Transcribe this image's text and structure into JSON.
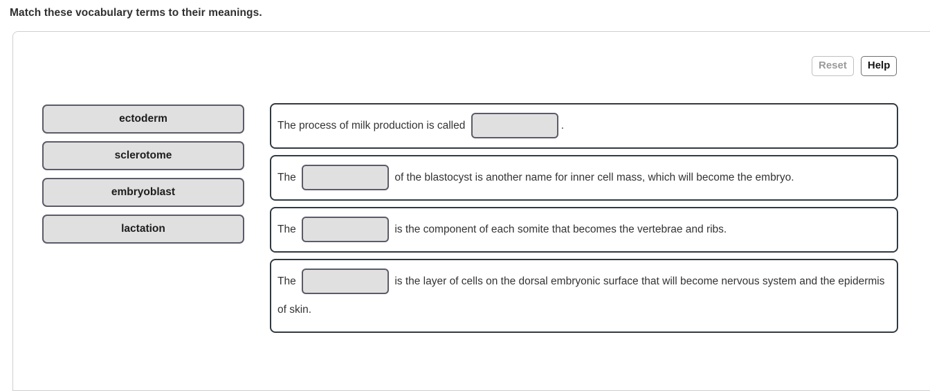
{
  "prompt": "Match these vocabulary terms to their meanings.",
  "toolbar": {
    "reset_label": "Reset",
    "help_label": "Help"
  },
  "term_bank": {
    "terms": [
      {
        "label": "ectoderm"
      },
      {
        "label": "sclerotome"
      },
      {
        "label": "embryoblast"
      },
      {
        "label": "lactation"
      }
    ]
  },
  "sentences": [
    {
      "before": "The process of milk production is called ",
      "slot_value": "",
      "after": "."
    },
    {
      "before": "The ",
      "slot_value": "",
      "after": " of the blastocyst is another name for inner cell mass, which will become the embryo."
    },
    {
      "before": "The ",
      "slot_value": "",
      "after": " is the component of each somite that becomes the vertebrae and ribs."
    },
    {
      "before": "The ",
      "slot_value": "",
      "after": " is the layer of cells on the dorsal embryonic surface that will become nervous system and the epidermis of skin."
    }
  ],
  "colors": {
    "tile_fill": "#e0e0e0",
    "tile_border": "#5b5b68",
    "sentence_border": "#2f3a41",
    "panel_border": "#cfcfcf",
    "text": "#333333"
  }
}
